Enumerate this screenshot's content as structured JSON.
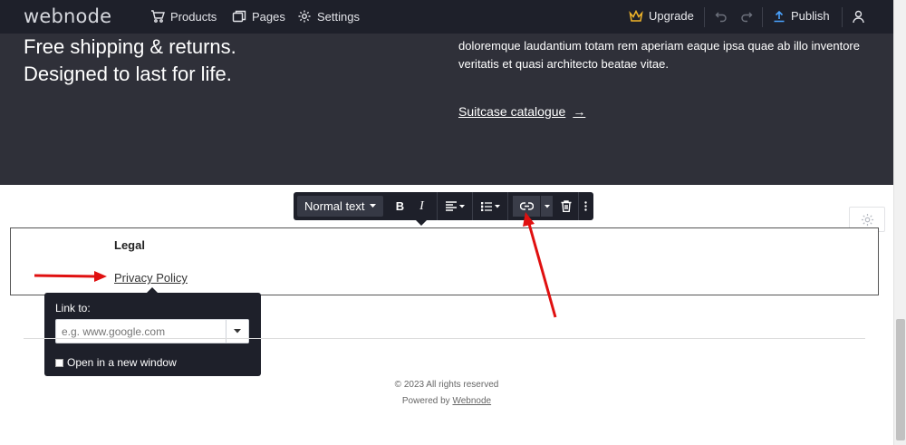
{
  "topbar": {
    "logo": "webnode",
    "nav": [
      {
        "label": "Products",
        "icon": "cart-icon"
      },
      {
        "label": "Pages",
        "icon": "pages-icon"
      },
      {
        "label": "Settings",
        "icon": "gear-icon"
      }
    ],
    "upgrade_label": "Upgrade",
    "publish_label": "Publish"
  },
  "hero": {
    "line1": "Free shipping & returns.",
    "line2": "Designed to last for life.",
    "paragraph": "doloremque laudantium totam rem aperiam eaque ipsa quae ab illo inventore veritatis et quasi architecto beatae vitae.",
    "link_label": "Suitcase catalogue",
    "link_arrow": "→"
  },
  "text_toolbar": {
    "format_label": "Normal text",
    "bold": "B",
    "italic": "I"
  },
  "legal": {
    "title": "Legal",
    "link": "Privacy Policy"
  },
  "link_popup": {
    "label": "Link to:",
    "placeholder": "e.g. www.google.com",
    "checkbox_label": "Open in a new window",
    "checked": false
  },
  "footer": {
    "copyright": "© 2023 All rights reserved",
    "powered_prefix": "Powered by ",
    "powered_link": "Webnode"
  },
  "colors": {
    "topbar_bg": "#1e202a",
    "hero_bg": "#2f3039",
    "upgrade_crown": "#f0b429",
    "publish_icon": "#4aa3ff",
    "annotation_arrow": "#e01010"
  }
}
